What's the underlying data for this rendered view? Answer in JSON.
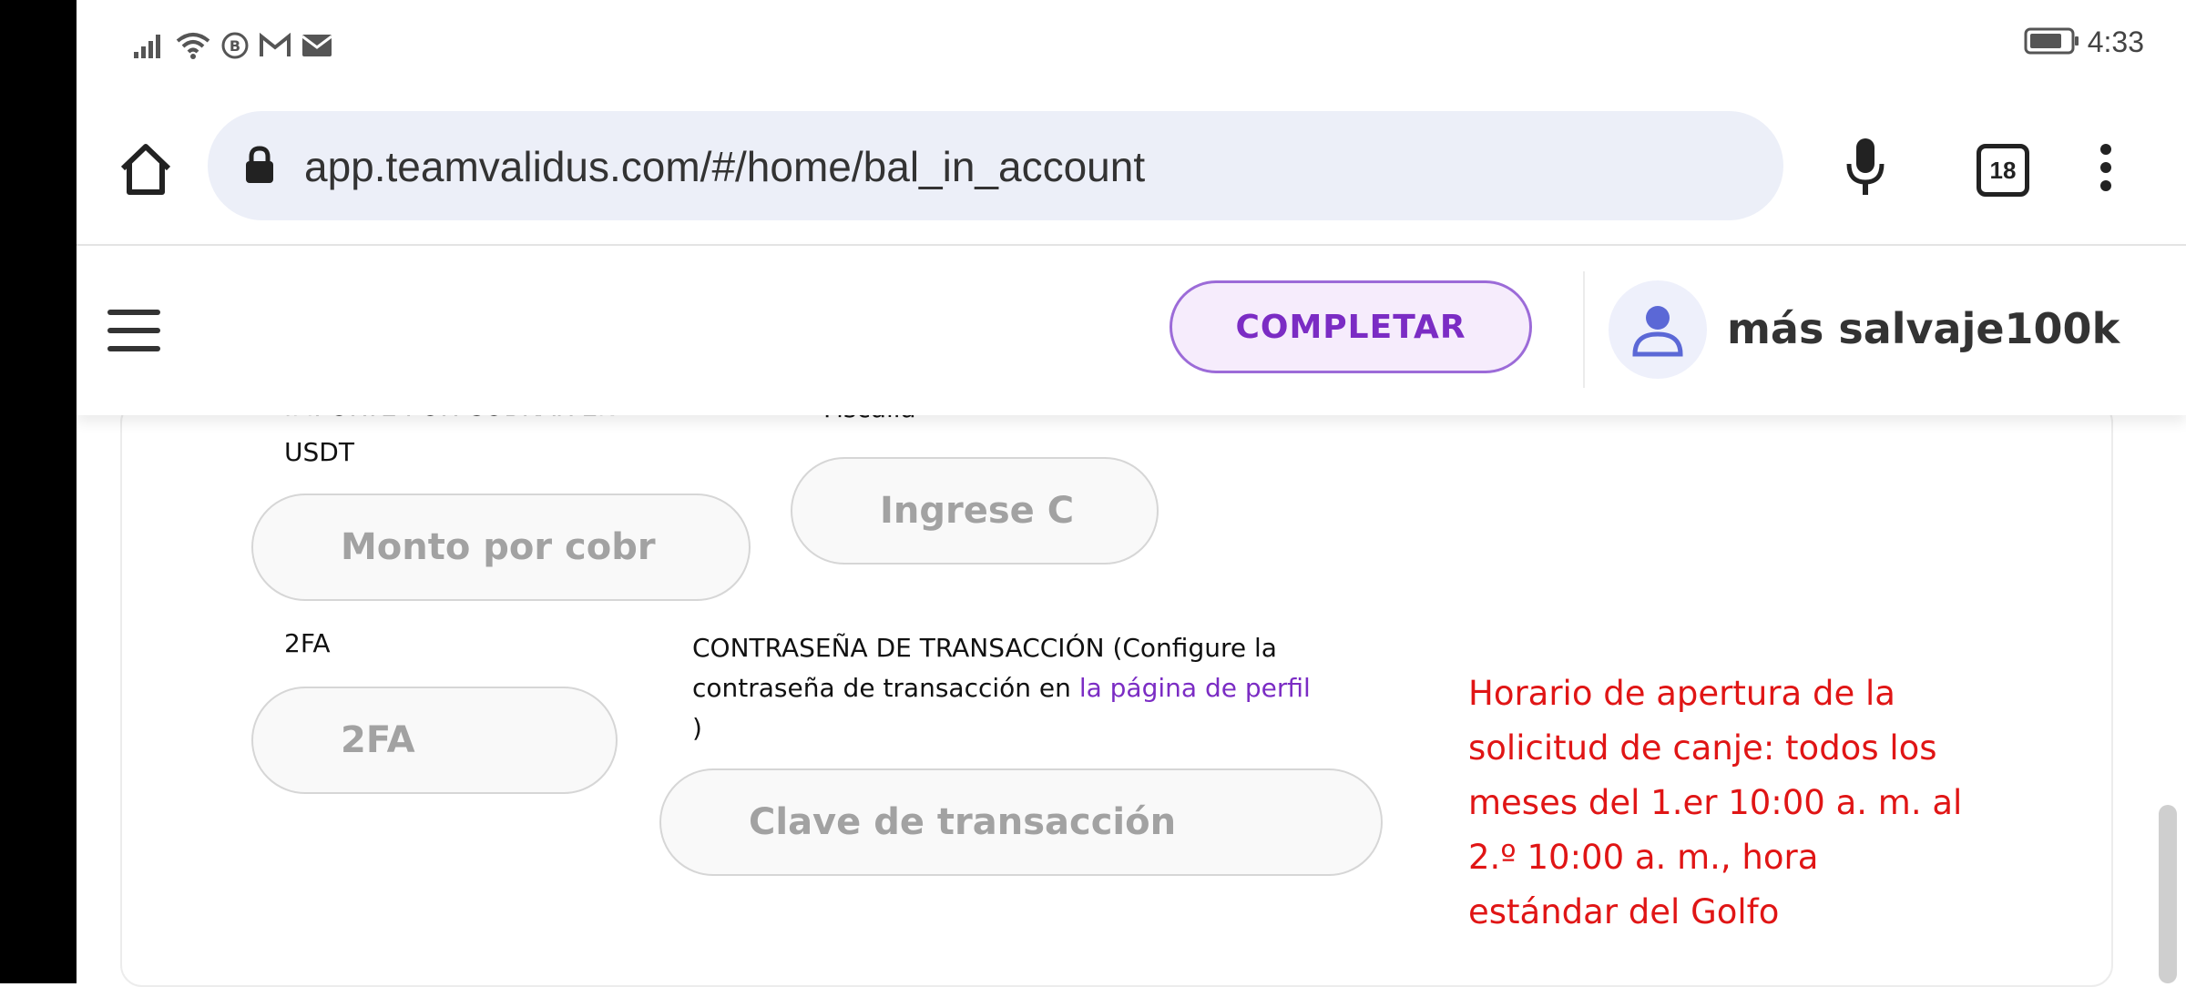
{
  "status_bar": {
    "time": "4:33",
    "icons": [
      "signal-icon",
      "wifi-icon",
      "b-icon",
      "gmail-icon",
      "mail-icon",
      "battery-icon"
    ]
  },
  "browser": {
    "url": "app.teamvalidus.com/#/home/bal_in_account",
    "tab_count": "18"
  },
  "header": {
    "complete_label": "COMPLETAR",
    "username": "más salvaje100k"
  },
  "form": {
    "amount_label_partial": "IMPORTE POR COBRAR EN",
    "amount_label_unit": "USDT",
    "amount_placeholder": "Monto por cobr",
    "second_label_partial": "Fiscalía",
    "second_placeholder": "Ingrese C",
    "twofa_label": "2FA",
    "twofa_placeholder": "2FA",
    "password_label_part1": "CONTRASEÑA DE TRANSACCIÓN (Configure la",
    "password_label_part2": "contraseña de transacción en ",
    "password_link": "la página de perfil",
    "password_label_close": ")",
    "password_placeholder": "Clave de transacción"
  },
  "notice": {
    "text": "Horario de apertura de la solicitud de canje: todos los meses del 1.er 10:00 a. m. al 2.º 10:00 a. m., hora estándar del Golfo"
  },
  "colors": {
    "accent": "#7b2cc4",
    "notice": "#e01515",
    "url_bg": "#eceff8"
  }
}
